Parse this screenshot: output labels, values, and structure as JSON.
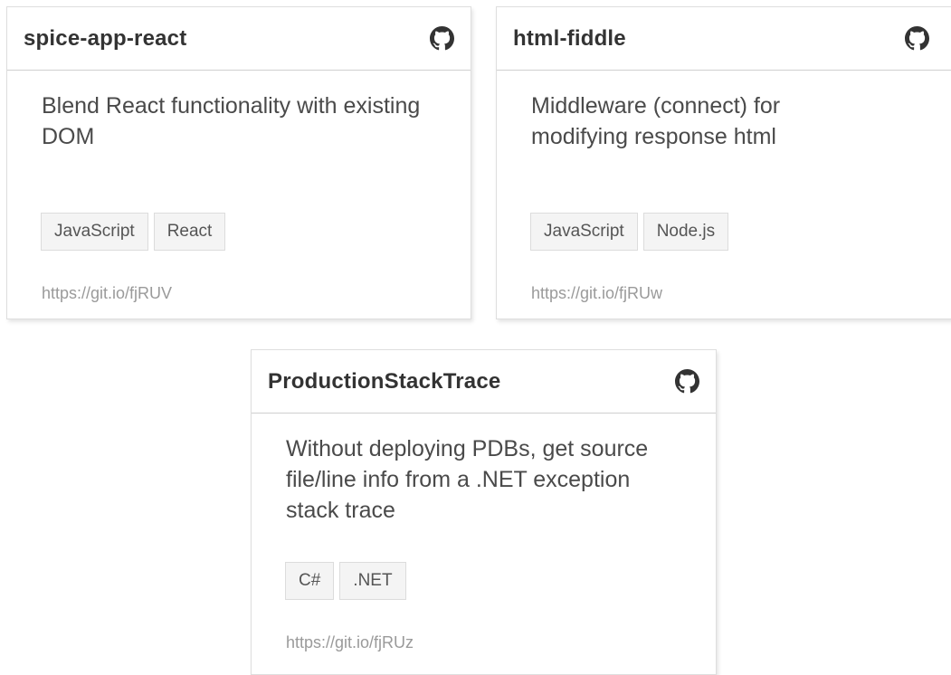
{
  "projects": [
    {
      "title": "spice-app-react",
      "description": "Blend React functionality with existing DOM",
      "tags": [
        "JavaScript",
        "React"
      ],
      "link": "https://git.io/fjRUV"
    },
    {
      "title": "html-fiddle",
      "description": "Middleware (connect) for modifying response html",
      "tags": [
        "JavaScript",
        "Node.js"
      ],
      "link": "https://git.io/fjRUw"
    },
    {
      "title": "ProductionStackTrace",
      "description": "Without deploying PDBs, get source file/line info from a .NET exception stack trace",
      "tags": [
        "C#",
        ".NET"
      ],
      "link": "https://git.io/fjRUz"
    }
  ],
  "icons": {
    "repo": "github-icon"
  },
  "colors": {
    "title": "#333333",
    "text": "#4a4a4a",
    "link": "#9a9a9a",
    "tag_bg": "#f4f4f4",
    "border": "#dedede"
  }
}
